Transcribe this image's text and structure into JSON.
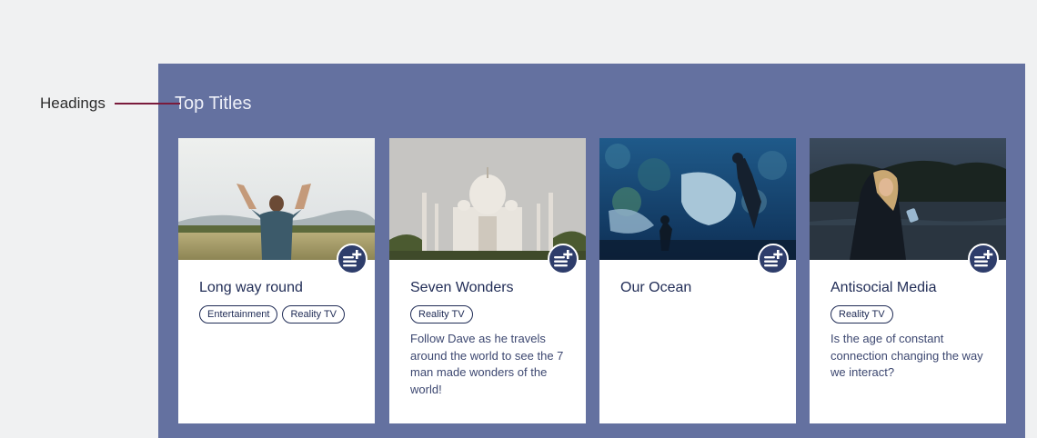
{
  "annotation": {
    "label": "Headings"
  },
  "section": {
    "title": "Top Titles"
  },
  "cards": [
    {
      "title": "Long way round",
      "tags": [
        "Entertainment",
        "Reality TV"
      ],
      "description": "",
      "image": "man-arms-raised-field",
      "action_icon": "add-to-playlist-icon"
    },
    {
      "title": "Seven Wonders",
      "tags": [
        "Reality TV"
      ],
      "description": "Follow Dave as he travels around the world to see the 7 man made wonders of the world!",
      "image": "taj-mahal",
      "action_icon": "add-to-playlist-icon"
    },
    {
      "title": "Our Ocean",
      "tags": [],
      "description": "",
      "image": "aquarium-diver-stingray",
      "action_icon": "add-to-playlist-icon"
    },
    {
      "title": "Antisocial Media",
      "tags": [
        "Reality TV"
      ],
      "description": "Is the age of constant connection changing the way we interact?",
      "image": "woman-phone-night-lake",
      "action_icon": "add-to-playlist-icon"
    }
  ],
  "colors": {
    "panel": "#6471a0",
    "card": "#ffffff",
    "button": "#2e3d6b",
    "text_dark": "#1f2b55",
    "annotation_line": "#7a1b3c"
  }
}
